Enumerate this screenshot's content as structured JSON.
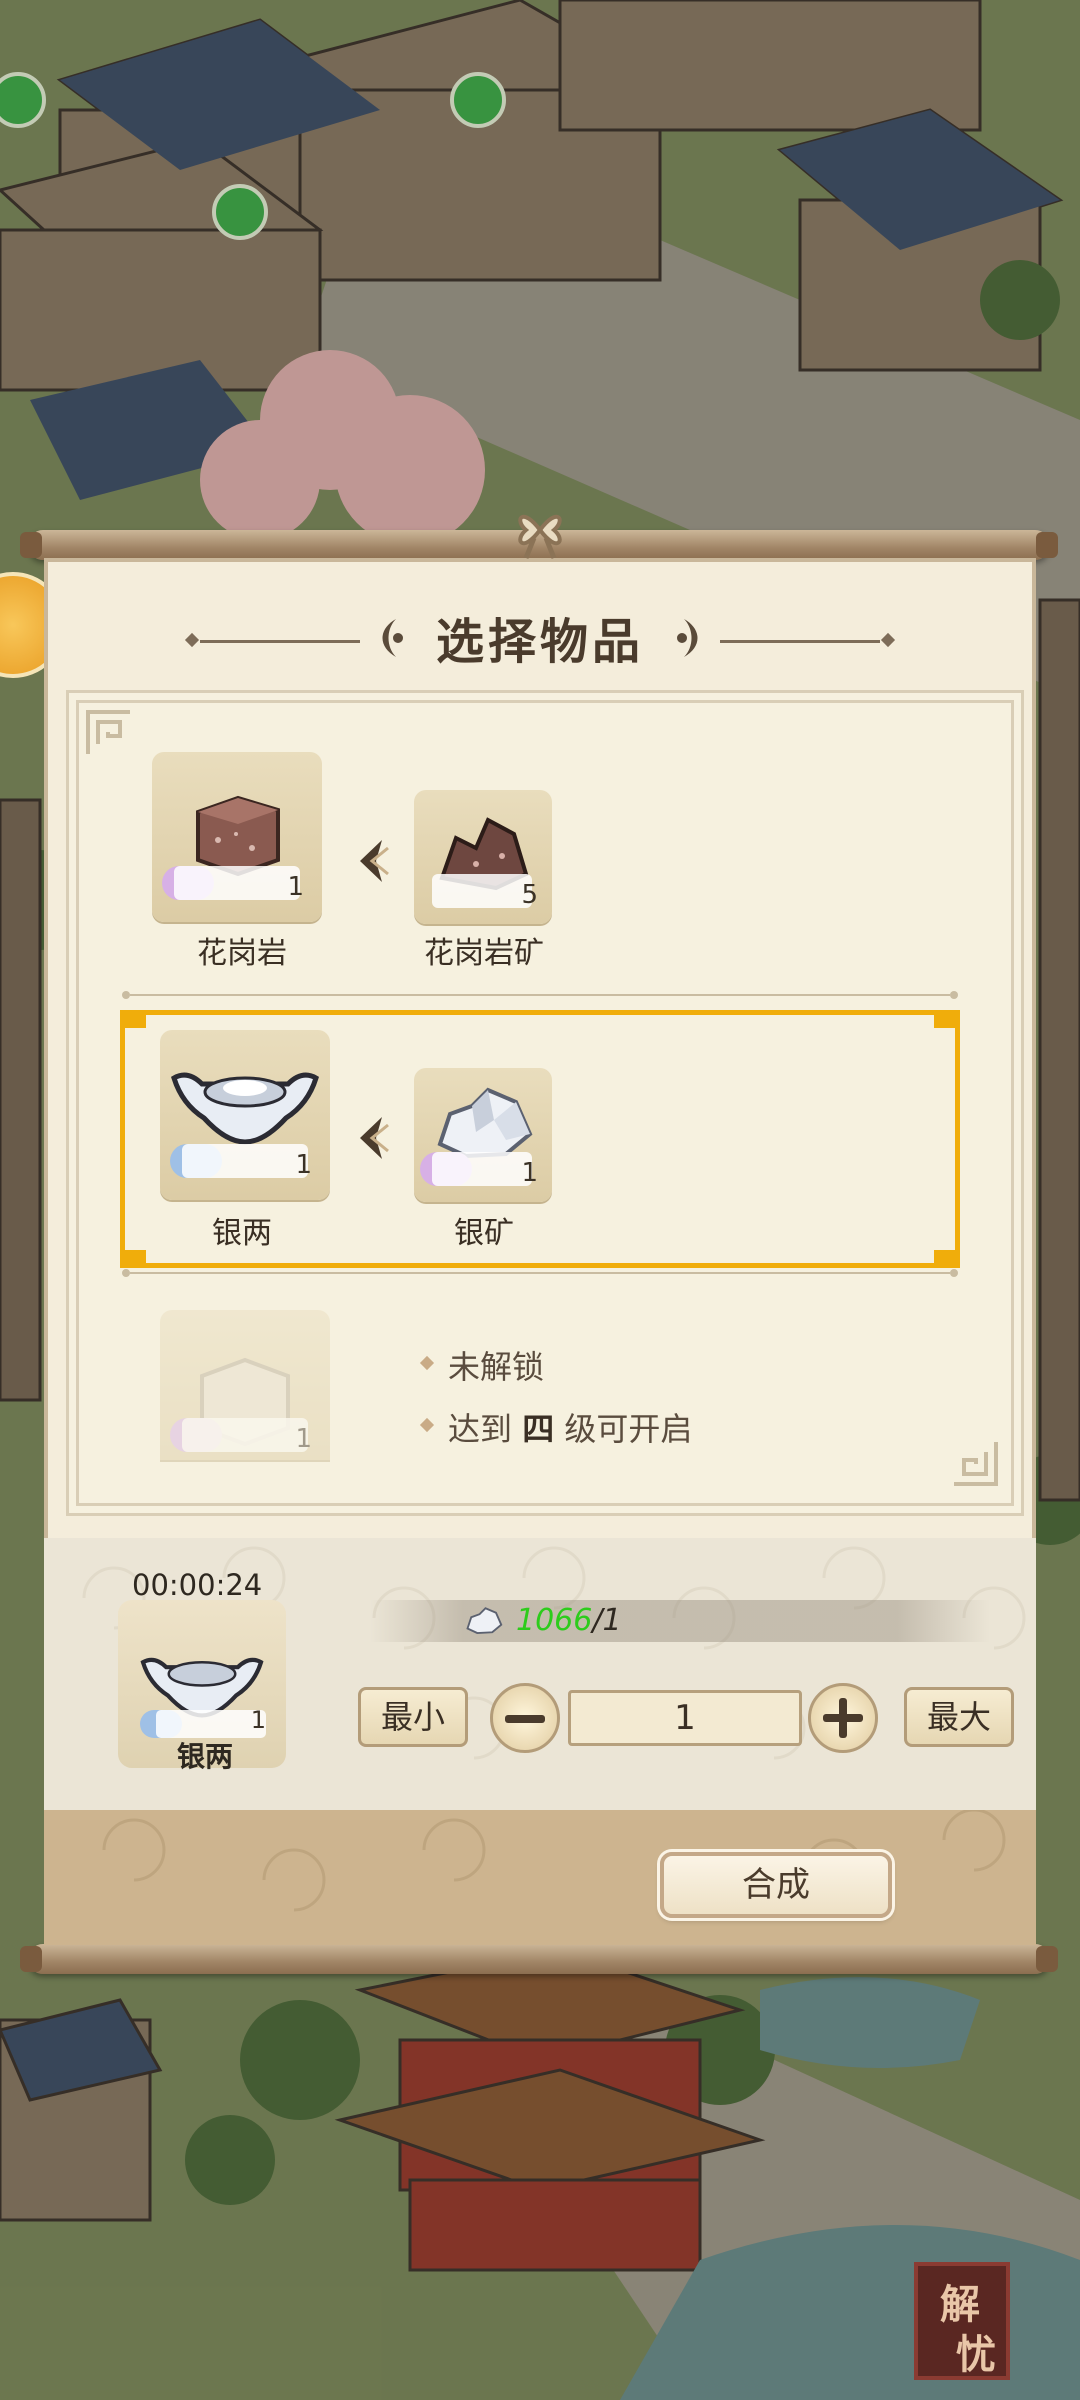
{
  "dialog": {
    "title": "选择物品"
  },
  "recipes": [
    {
      "output": {
        "name": "花岗岩",
        "qty": "1",
        "icon": "granite-block-icon"
      },
      "input": {
        "name": "花岗岩矿",
        "qty": "5",
        "icon": "granite-ore-icon"
      },
      "selected": false
    },
    {
      "output": {
        "name": "银两",
        "qty": "1",
        "icon": "silver-ingot-icon"
      },
      "input": {
        "name": "银矿",
        "qty": "1",
        "icon": "silver-ore-icon"
      },
      "selected": true
    },
    {
      "output": {
        "qty": "1",
        "icon": "locked-item-icon"
      },
      "locked": true,
      "hint_locked": "未解锁",
      "hint_unlock_prefix": "达到 ",
      "hint_unlock_level": "四",
      "hint_unlock_suffix": " 级可开启"
    }
  ],
  "craft": {
    "timer": "00:00:24",
    "product_name": "银两",
    "product_qty": "1",
    "cost_have": "1066",
    "cost_sep": "/",
    "cost_need": "1",
    "cost_icon": "silver-ore-icon",
    "min_label": "最小",
    "max_label": "最大",
    "quantity": "1",
    "combine_label": "合成"
  },
  "seal": {
    "text_1": "解",
    "text_2": "忧"
  },
  "colors": {
    "selection": "#f0ad0b",
    "cost_have": "#2dcc1c",
    "panel": "#f4eddb"
  }
}
